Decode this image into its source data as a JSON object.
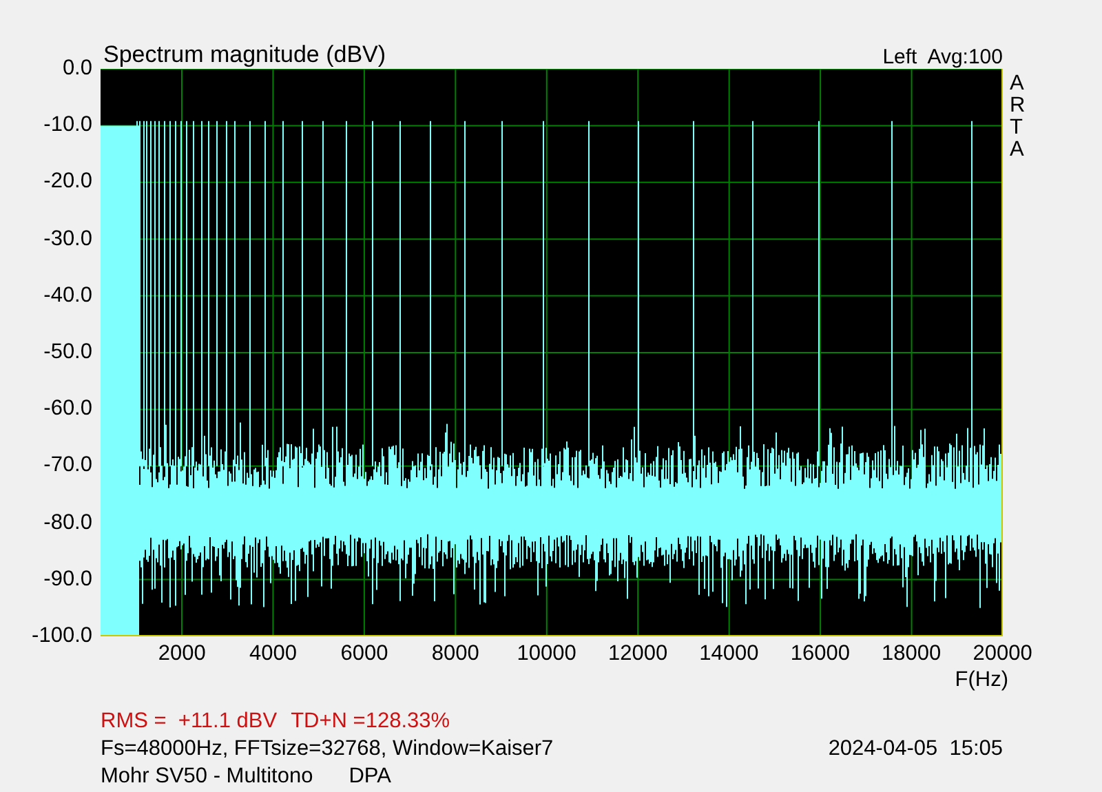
{
  "title": "Spectrum magnitude (dBV)",
  "channel": "Left",
  "average": "Avg:100",
  "brand_letters": [
    "A",
    "R",
    "T",
    "A"
  ],
  "y_ticks": [
    "0.0",
    "-10.0",
    "-20.0",
    "-30.0",
    "-40.0",
    "-50.0",
    "-60.0",
    "-70.0",
    "-80.0",
    "-90.0",
    "-100.0"
  ],
  "x_ticks": [
    "2000",
    "4000",
    "6000",
    "8000",
    "10000",
    "12000",
    "14000",
    "16000",
    "18000",
    "20000"
  ],
  "x_axis_label": "F(Hz)",
  "measurement": {
    "rms": "RMS =  +11.1 dBV",
    "thd": "TD+N =128.33%"
  },
  "settings": "Fs=48000Hz, FFTsize=32768, Window=Kaiser7",
  "timestamp": {
    "date": "2024-04-05",
    "time": "15:05"
  },
  "device": "Mohr SV50 - Multitono",
  "probe": "DPA"
}
